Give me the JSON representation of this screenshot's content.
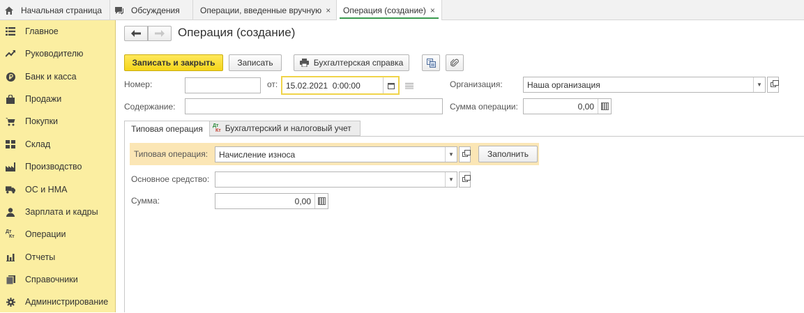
{
  "tabs": [
    {
      "label": "Начальная страница",
      "icon": "home-icon"
    },
    {
      "label": "Обсуждения",
      "icon": "chat-icon"
    },
    {
      "label": "Операции, введенные вручную",
      "closable": true
    },
    {
      "label": "Операция (создание)",
      "closable": true,
      "active": true
    }
  ],
  "close_glyph": "×",
  "sidebar": {
    "items": [
      {
        "label": "Главное",
        "icon": "menu-lines-icon"
      },
      {
        "label": "Руководителю",
        "icon": "trend-up-icon"
      },
      {
        "label": "Банк и касса",
        "icon": "ruble-coin-icon"
      },
      {
        "label": "Продажи",
        "icon": "shopping-bag-icon"
      },
      {
        "label": "Покупки",
        "icon": "cart-icon"
      },
      {
        "label": "Склад",
        "icon": "warehouse-icon"
      },
      {
        "label": "Производство",
        "icon": "factory-icon"
      },
      {
        "label": "ОС и НМА",
        "icon": "truck-icon"
      },
      {
        "label": "Зарплата и кадры",
        "icon": "person-icon"
      },
      {
        "label": "Операции",
        "icon": "dt-kt-icon"
      },
      {
        "label": "Отчеты",
        "icon": "bar-chart-icon"
      },
      {
        "label": "Справочники",
        "icon": "books-icon"
      },
      {
        "label": "Администрирование",
        "icon": "gear-icon"
      }
    ],
    "dtkt_top": "Дт",
    "dtkt_bottom": "Кт"
  },
  "form": {
    "title": "Операция (создание)",
    "buttons": {
      "save_close": "Записать и закрыть",
      "save": "Записать",
      "accounting_note": "Бухгалтерская справка"
    },
    "number_label": "Номер:",
    "number_value": "",
    "from_label": "от:",
    "date_value": "15.02.2021  0:00:00",
    "org_label": "Организация:",
    "org_value": "Наша организация",
    "content_label": "Содержание:",
    "content_value": "",
    "sum_op_label": "Сумма операции:",
    "sum_op_value": "0,00",
    "tabs": [
      {
        "label": "Типовая операция",
        "active": true
      },
      {
        "label": "Бухгалтерский и налоговый учет",
        "icon_top": "Дт",
        "icon_bottom": "Кт"
      }
    ],
    "typical_op_label": "Типовая операция:",
    "typical_op_value": "Начисление износа",
    "fill_button": "Заполнить",
    "asset_label": "Основное средство:",
    "asset_value": "",
    "sum_label": "Сумма:",
    "sum_value": "0,00"
  },
  "colors": {
    "sidebar_bg": "#fbeea1",
    "primary_button": "#f5d51b",
    "active_tab_underline": "#3a9a4f",
    "highlight_panel": "#fbe6b5"
  }
}
